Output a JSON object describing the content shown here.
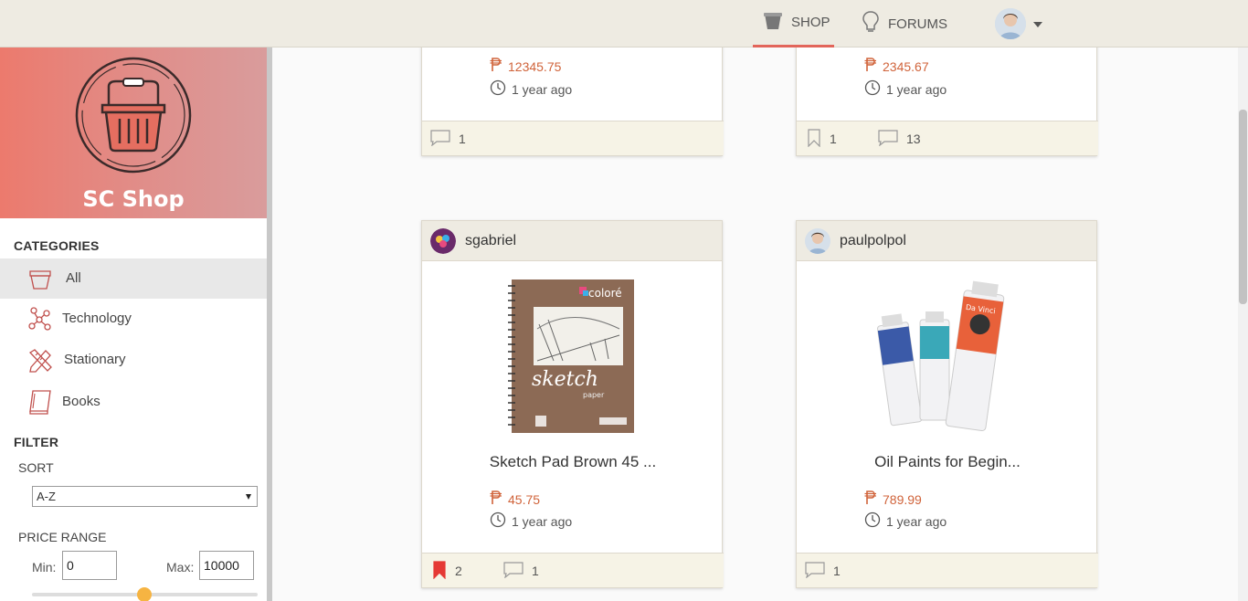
{
  "topnav": {
    "shop_label": "SHOP",
    "forums_label": "FORUMS"
  },
  "sidebar": {
    "brand_name": "SC Shop",
    "categories_title": "CATEGORIES",
    "categories": [
      {
        "label": "All",
        "icon": "basket-icon",
        "active": true
      },
      {
        "label": "Technology",
        "icon": "circuit-icon"
      },
      {
        "label": "Stationary",
        "icon": "pencil-ruler-icon"
      },
      {
        "label": "Books",
        "icon": "book-icon"
      }
    ],
    "filter_title": "FILTER",
    "sort_title": "SORT",
    "sort_value": "A-Z",
    "price_range_title": "PRICE RANGE",
    "min_label": "Min:",
    "min_value": "0",
    "max_label": "Max:",
    "max_value": "10000"
  },
  "cards": [
    {
      "price": "12345.75",
      "time": "1 year ago",
      "comments": "1"
    },
    {
      "price": "2345.67",
      "time": "1 year ago",
      "bookmarks": "1",
      "comments": "13"
    },
    {
      "username": "sgabriel",
      "title": "Sketch Pad Brown 45 ...",
      "price": "45.75",
      "time": "1 year ago",
      "bookmarks": "2",
      "comments": "1",
      "image_brand": "coloré",
      "image_text": "sketch",
      "image_subtext": "paper"
    },
    {
      "username": "paulpolpol",
      "title": "Oil Paints for Begin...",
      "price": "789.99",
      "time": "1 year ago",
      "comments": "1",
      "image_label": "Da Vinci"
    }
  ],
  "colors": {
    "accent": "#e2655a",
    "price": "#d0633a",
    "header_bg": "#eeebe2",
    "footer_bg": "#f6f3e6",
    "bookmark_active": "#e53935"
  }
}
